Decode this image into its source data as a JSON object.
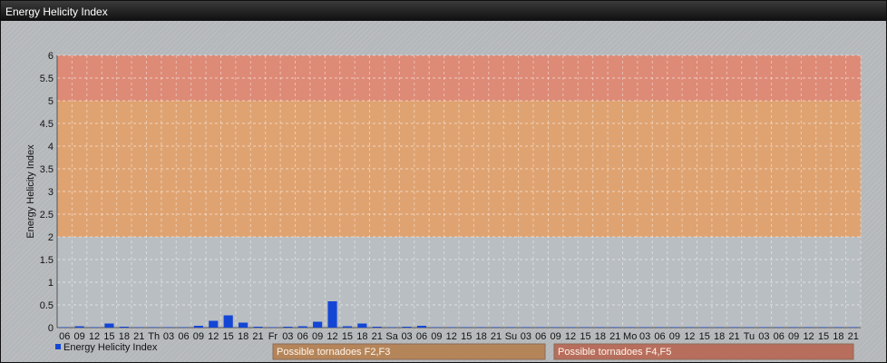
{
  "window": {
    "title": "Energy Helicity Index"
  },
  "chart_data": {
    "type": "bar",
    "ylabel": "Energy Helicity Index",
    "ylim": [
      0,
      6
    ],
    "yticks": [
      "0",
      "0.5",
      "1",
      "1.5",
      "2",
      "2.5",
      "3",
      "3.5",
      "4",
      "4.5",
      "5",
      "5.5",
      "6"
    ],
    "categories": [
      "06",
      "09",
      "12",
      "15",
      "18",
      "21",
      "Th",
      "03",
      "06",
      "09",
      "12",
      "15",
      "18",
      "21",
      "Fr",
      "03",
      "06",
      "09",
      "12",
      "15",
      "18",
      "21",
      "Sa",
      "03",
      "06",
      "09",
      "12",
      "15",
      "18",
      "21",
      "Su",
      "03",
      "06",
      "09",
      "12",
      "15",
      "18",
      "21",
      "Mo",
      "03",
      "06",
      "09",
      "12",
      "15",
      "18",
      "21",
      "Tu",
      "03",
      "06",
      "09",
      "12",
      "15",
      "18",
      "21"
    ],
    "series": [
      {
        "name": "Energy Helicity Index",
        "color": "#1446d6",
        "values": [
          0.01,
          0.03,
          0.01,
          0.09,
          0.02,
          0.01,
          0.01,
          0.01,
          0.01,
          0.04,
          0.15,
          0.27,
          0.11,
          0.02,
          0.01,
          0.02,
          0.03,
          0.13,
          0.58,
          0.03,
          0.09,
          0.02,
          0.01,
          0.02,
          0.04,
          0.01,
          0.01,
          0.01,
          0.01,
          0.01,
          0.01,
          0.01,
          0.01,
          0.01,
          0.01,
          0.01,
          0.01,
          0.01,
          0.01,
          0.01,
          0.01,
          0.01,
          0.01,
          0.01,
          0.01,
          0.01,
          0.01,
          0.01,
          0.01,
          0.01,
          0.01,
          0.01,
          0.01,
          0.01
        ]
      }
    ],
    "bands": [
      {
        "from": 2,
        "to": 5,
        "label": "Possible tornadoes F2,F3",
        "color": "#e2a16a"
      },
      {
        "from": 5,
        "to": 6,
        "label": "Possible tornadoes F4,F5",
        "color": "#e08670"
      }
    ],
    "grid": true,
    "legend": "bottom-left"
  }
}
